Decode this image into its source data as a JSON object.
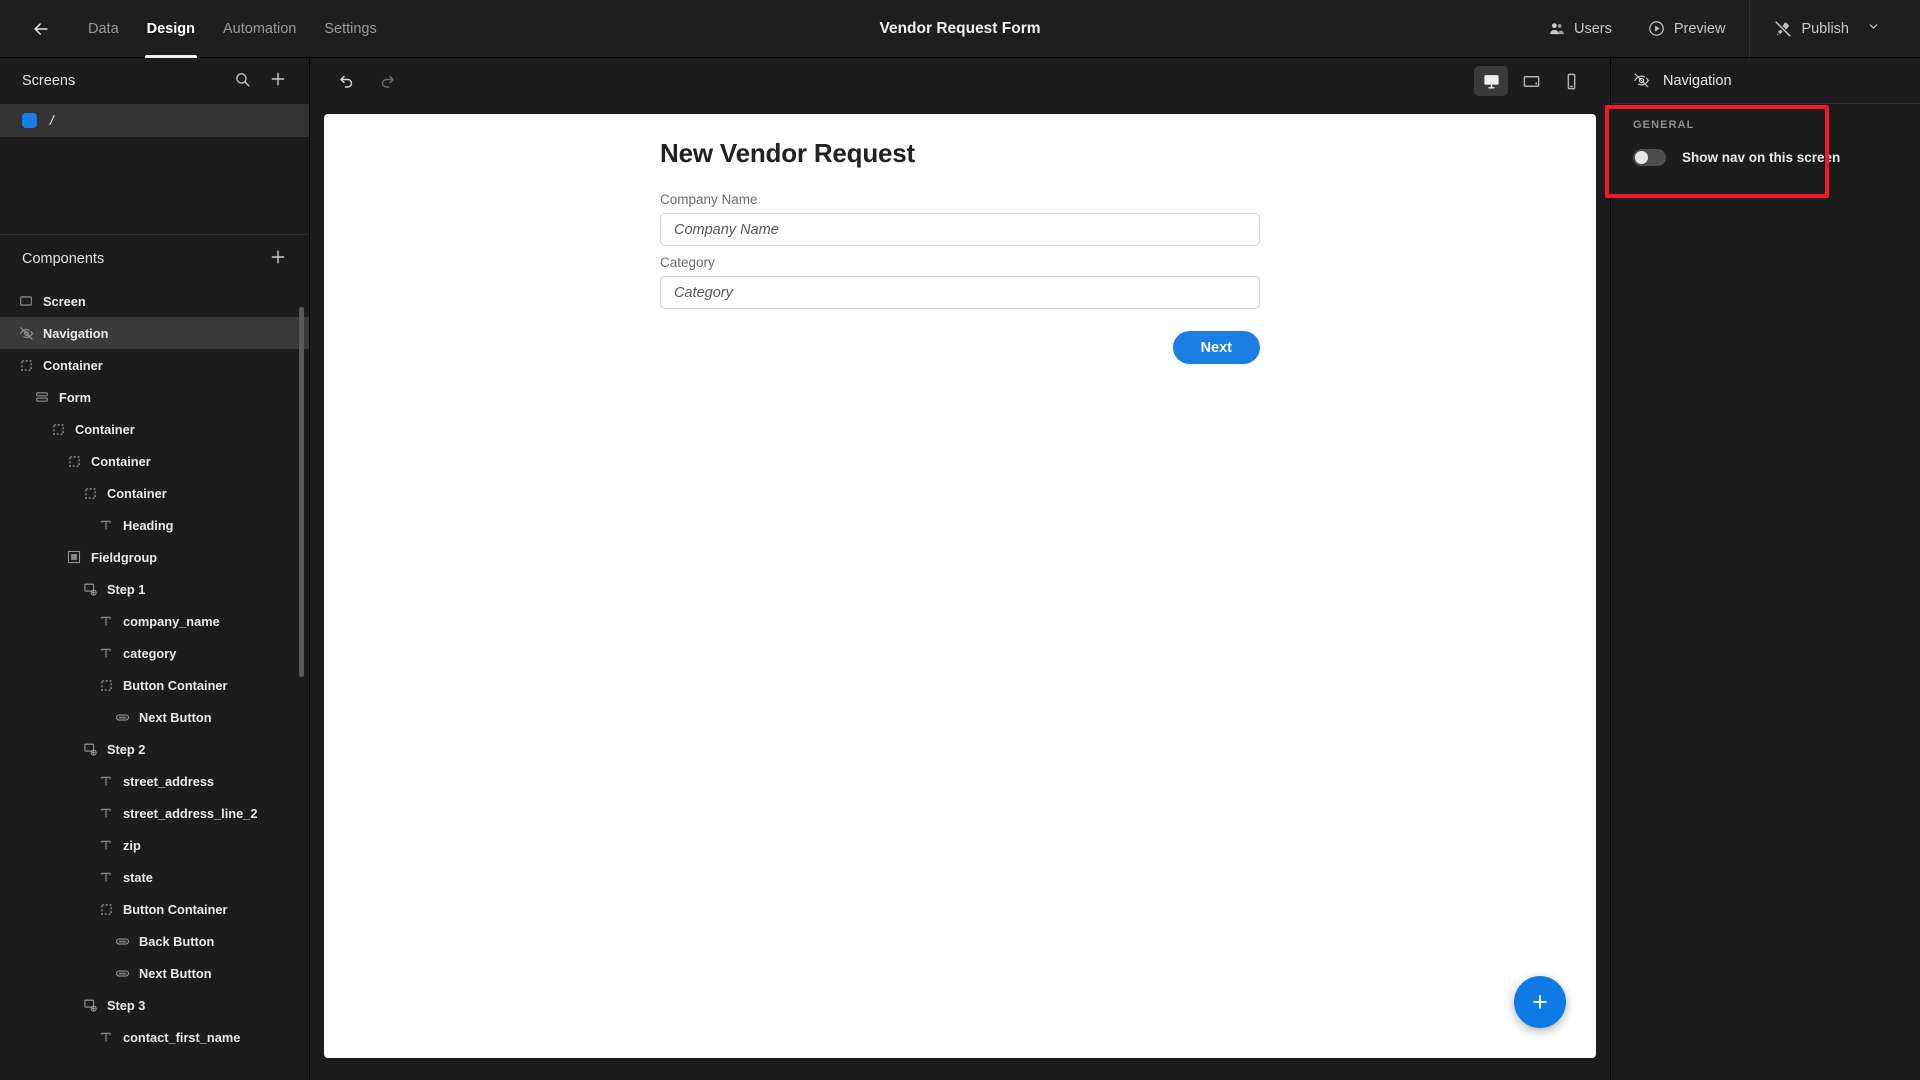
{
  "topbar": {
    "back_icon": "arrow-left-icon",
    "tabs": [
      {
        "label": "Data",
        "active": false
      },
      {
        "label": "Design",
        "active": true
      },
      {
        "label": "Automation",
        "active": false
      },
      {
        "label": "Settings",
        "active": false
      }
    ],
    "title": "Vendor Request Form",
    "users_label": "Users",
    "preview_label": "Preview",
    "publish_label": "Publish",
    "chevron": "⌄"
  },
  "screens_panel": {
    "title": "Screens",
    "search_icon": "search-icon",
    "add_icon": "plus-icon",
    "items": [
      {
        "label": "/",
        "selected": true
      }
    ]
  },
  "components_panel": {
    "title": "Components",
    "add_icon": "plus-icon",
    "tree": [
      {
        "label": "Screen",
        "depth": 0,
        "icon": "screen-icon",
        "selected": false
      },
      {
        "label": "Navigation",
        "depth": 0,
        "icon": "eye-off-icon",
        "selected": true
      },
      {
        "label": "Container",
        "depth": 0,
        "icon": "container-icon",
        "selected": false
      },
      {
        "label": "Form",
        "depth": 1,
        "icon": "form-icon",
        "selected": false
      },
      {
        "label": "Container",
        "depth": 2,
        "icon": "container-icon",
        "selected": false
      },
      {
        "label": "Container",
        "depth": 3,
        "icon": "container-icon",
        "selected": false
      },
      {
        "label": "Container",
        "depth": 4,
        "icon": "container-icon",
        "selected": false
      },
      {
        "label": "Heading",
        "depth": 5,
        "icon": "text-icon",
        "selected": false
      },
      {
        "label": "Fieldgroup",
        "depth": 3,
        "icon": "fieldgroup-icon",
        "selected": false
      },
      {
        "label": "Step 1",
        "depth": 4,
        "icon": "step-icon",
        "selected": false
      },
      {
        "label": "company_name",
        "depth": 5,
        "icon": "text-icon",
        "selected": false
      },
      {
        "label": "category",
        "depth": 5,
        "icon": "text-icon",
        "selected": false
      },
      {
        "label": "Button Container",
        "depth": 5,
        "icon": "container-icon",
        "selected": false
      },
      {
        "label": "Next Button",
        "depth": 6,
        "icon": "button-icon",
        "selected": false
      },
      {
        "label": "Step 2",
        "depth": 4,
        "icon": "step-icon",
        "selected": false
      },
      {
        "label": "street_address",
        "depth": 5,
        "icon": "text-icon",
        "selected": false
      },
      {
        "label": "street_address_line_2",
        "depth": 5,
        "icon": "text-icon",
        "selected": false
      },
      {
        "label": "zip",
        "depth": 5,
        "icon": "text-icon",
        "selected": false
      },
      {
        "label": "state",
        "depth": 5,
        "icon": "text-icon",
        "selected": false
      },
      {
        "label": "Button Container",
        "depth": 5,
        "icon": "container-icon",
        "selected": false
      },
      {
        "label": "Back Button",
        "depth": 6,
        "icon": "button-icon",
        "selected": false
      },
      {
        "label": "Next Button",
        "depth": 6,
        "icon": "button-icon",
        "selected": false
      },
      {
        "label": "Step 3",
        "depth": 4,
        "icon": "step-icon",
        "selected": false
      },
      {
        "label": "contact_first_name",
        "depth": 5,
        "icon": "text-icon",
        "selected": false
      }
    ]
  },
  "canvas_toolbar": {
    "undo_icon": "undo-icon",
    "redo_icon": "redo-icon",
    "devices": [
      {
        "name": "desktop",
        "icon": "desktop-icon",
        "active": true
      },
      {
        "name": "tablet",
        "icon": "tablet-icon",
        "active": false
      },
      {
        "name": "mobile",
        "icon": "mobile-icon",
        "active": false
      }
    ]
  },
  "canvas": {
    "heading": "New Vendor Request",
    "fields": [
      {
        "label": "Company Name",
        "value": "",
        "placeholder": "Company Name"
      },
      {
        "label": "Category",
        "value": "",
        "placeholder": "Category"
      }
    ],
    "next_button": "Next",
    "fab_icon": "plus-icon",
    "fab_label": "+"
  },
  "right_panel": {
    "header_icon": "eye-off-icon",
    "header_title": "Navigation",
    "section_title": "GENERAL",
    "toggle_label": "Show nav on this screen",
    "toggle_on": false,
    "highlight_color": "#f5152f"
  },
  "colors": {
    "accent_blue": "#1a7ee5",
    "panel_bg": "#1c1c1c",
    "topbar_bg": "#1e1e1e",
    "selected_row": "#3a3a3a",
    "highlight_red": "#f5152f"
  }
}
